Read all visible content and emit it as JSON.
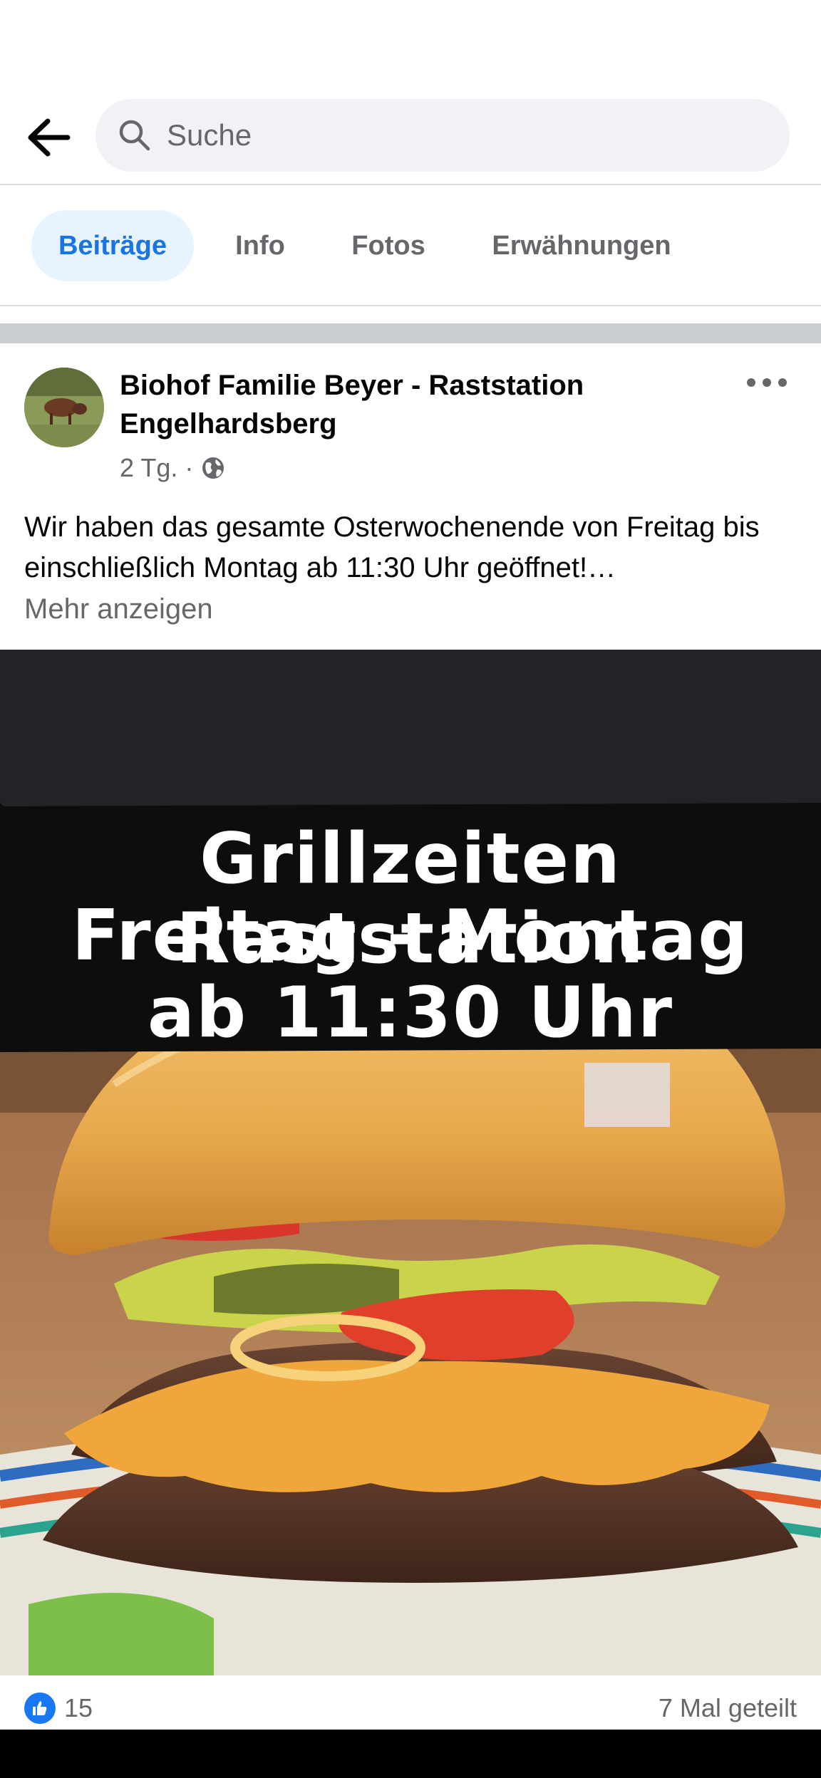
{
  "header": {
    "back_icon": "arrow-left-icon",
    "search": {
      "placeholder": "Suche",
      "icon": "search-icon"
    }
  },
  "tabs": [
    {
      "label": "Beiträge",
      "active": true
    },
    {
      "label": "Info",
      "active": false
    },
    {
      "label": "Fotos",
      "active": false
    },
    {
      "label": "Erwähnungen",
      "active": false
    }
  ],
  "post": {
    "author": "Biohof Familie Beyer - Raststation Engelhardsberg",
    "time": "2 Tg.",
    "separator": "·",
    "audience_icon": "globe-icon",
    "text": "Wir haben das gesamte Osterwochenende von Freitag bis einschließlich Montag ab 11:30 Uhr geöffnet!…",
    "see_more": "Mehr anzeigen",
    "image": {
      "line1": "Grillzeiten Raststation",
      "line2": "Freitag - Montag",
      "line3": "ab 11:30 Uhr"
    },
    "likes": "15",
    "shares": "7 Mal geteilt"
  },
  "colors": {
    "accent": "#1b74e4",
    "active_tab_bg": "#e7f3ff",
    "secondary_text": "#65676b",
    "like_blue": "#1877f2"
  }
}
